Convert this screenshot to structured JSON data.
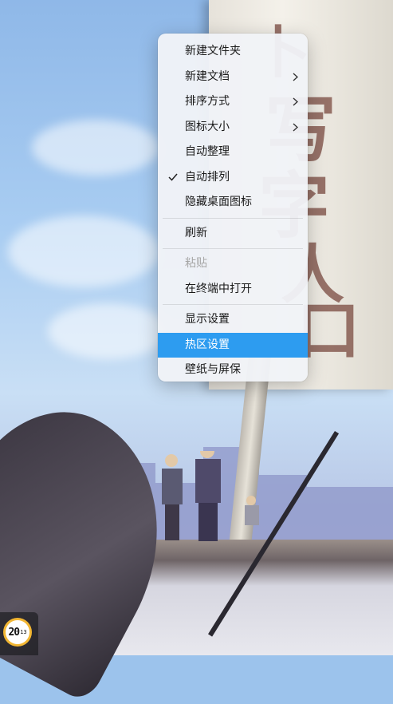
{
  "desktop": {
    "wallpaper_banner_glyphs": [
      "卜",
      "写",
      "字",
      "人",
      "口"
    ]
  },
  "context_menu": {
    "items": [
      {
        "label": "新建文件夹",
        "submenu": false,
        "checked": false,
        "disabled": false,
        "highlighted": false
      },
      {
        "label": "新建文档",
        "submenu": true,
        "checked": false,
        "disabled": false,
        "highlighted": false
      },
      {
        "label": "排序方式",
        "submenu": true,
        "checked": false,
        "disabled": false,
        "highlighted": false
      },
      {
        "label": "图标大小",
        "submenu": true,
        "checked": false,
        "disabled": false,
        "highlighted": false
      },
      {
        "label": "自动整理",
        "submenu": false,
        "checked": false,
        "disabled": false,
        "highlighted": false
      },
      {
        "label": "自动排列",
        "submenu": false,
        "checked": true,
        "disabled": false,
        "highlighted": false
      },
      {
        "label": "隐藏桌面图标",
        "submenu": false,
        "checked": false,
        "disabled": false,
        "highlighted": false
      },
      {
        "label": "刷新",
        "submenu": false,
        "checked": false,
        "disabled": false,
        "highlighted": false
      },
      {
        "label": "粘贴",
        "submenu": false,
        "checked": false,
        "disabled": true,
        "highlighted": false
      },
      {
        "label": "在终端中打开",
        "submenu": false,
        "checked": false,
        "disabled": false,
        "highlighted": false
      },
      {
        "label": "显示设置",
        "submenu": false,
        "checked": false,
        "disabled": false,
        "highlighted": false
      },
      {
        "label": "热区设置",
        "submenu": false,
        "checked": false,
        "disabled": false,
        "highlighted": true
      },
      {
        "label": "壁纸与屏保",
        "submenu": false,
        "checked": false,
        "disabled": false,
        "highlighted": false
      }
    ],
    "highlight_color": "#2d9cf0",
    "disabled_color": "#a6a6a6",
    "chevron_icon": "chevron-right-icon",
    "check_icon": "checkmark-icon"
  },
  "dock": {
    "clock": {
      "hour": "20",
      "minute": "13"
    }
  }
}
